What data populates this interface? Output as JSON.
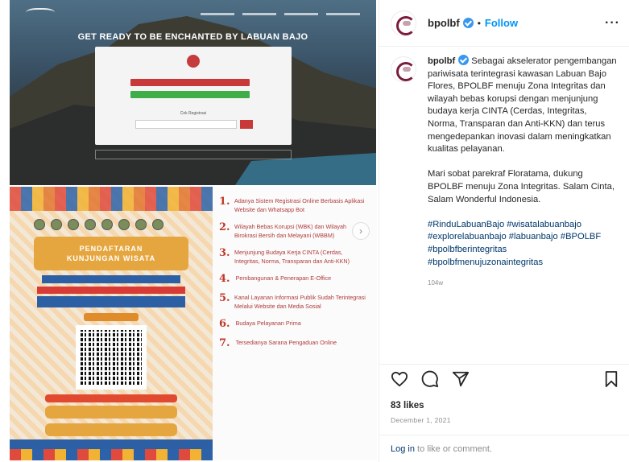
{
  "post_media": {
    "hero": {
      "headline": "GET READY TO BE ENCHANTED BY LABUAN BAJO",
      "register_label": "Cek Registrasi"
    },
    "poster": {
      "title_line1": "PENDAFTARAN",
      "title_line2": "KUNJUNGAN WISATA"
    },
    "list": [
      {
        "num": "1.",
        "text": "Adanya Sistem Registrasi Online Berbasis Aplikasi Website dan Whatsapp Bot"
      },
      {
        "num": "2.",
        "text": "Wilayah Bebas Korupsi (WBK) dan Wilayah Birokrasi Bersih dan Melayani (WBBM)"
      },
      {
        "num": "3.",
        "text": "Menjunjung Budaya Kerja CINTA (Cerdas, Integritas, Norma, Transparan dan Anti-KKN)"
      },
      {
        "num": "4.",
        "text": "Pembangunan & Penerapan E-Office"
      },
      {
        "num": "5.",
        "text": "Kanal Layanan Informasi Publik Sudah Terintegrasi Melalui Website dan Media Sosial"
      },
      {
        "num": "6.",
        "text": "Budaya Pelayanan Prima"
      },
      {
        "num": "7.",
        "text": "Tersedianya Sarana Pengaduan Online"
      }
    ]
  },
  "header": {
    "username": "bpolbf",
    "separator": "•",
    "follow_label": "Follow",
    "more_label": "···"
  },
  "caption": {
    "username": "bpolbf",
    "para1": "Sebagai akselerator pengembangan pariwisata terintegrasi kawasan Labuan Bajo Flores, BPOLBF menuju Zona Integritas dan wilayah bebas korupsi dengan menjunjung budaya kerja CINTA (Cerdas, Integritas, Norma, Transparan dan Anti-KKN) dan terus mengedepankan inovasi dalam meningkatkan kualitas pelayanan.",
    "para2": "Mari sobat parekraf Floratama, dukung BPOLBF menuju Zona Integritas. Salam Cinta, Salam Wonderful Indonesia.",
    "hashtags": "#RinduLabuanBajo #wisatalabuanbajo #explorelabuanbajo #labuanbajo #BPOLBF #bpolbfberintegritas #bpolbfmenujuzonaintegritas",
    "age": "104w"
  },
  "actions": {
    "like_icon": "heart-icon",
    "comment_icon": "comment-icon",
    "share_icon": "share-icon",
    "save_icon": "bookmark-icon"
  },
  "stats": {
    "likes": "83 likes",
    "date": "December 1, 2021"
  },
  "footer": {
    "login_link": "Log in",
    "login_rest": " to like or comment."
  },
  "colors": {
    "link": "#00376b",
    "follow": "#0095f6",
    "list_number": "#c0392b"
  }
}
